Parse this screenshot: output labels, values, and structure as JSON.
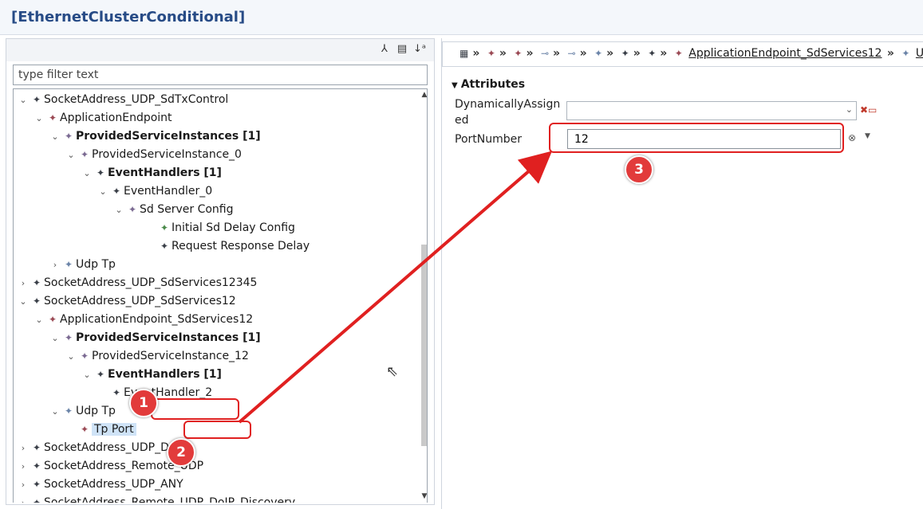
{
  "window": {
    "title": "[EthernetClusterConditional]"
  },
  "left_panel": {
    "toolbar_icons": [
      "merge-icon",
      "document-icon",
      "sort-az-icon"
    ],
    "filter_placeholder": "type filter text",
    "tree": [
      {
        "label": "SocketAddress_UDP_SdTxControl",
        "twisty": "expanded",
        "icon": "dark",
        "bold": false,
        "selected": false
      },
      {
        "label": "ApplicationEndpoint",
        "twisty": "expanded",
        "icon": "red",
        "bold": false,
        "selected": false
      },
      {
        "label": "ProvidedServiceInstances [1]",
        "twisty": "expanded",
        "icon": "purple",
        "bold": true,
        "selected": false
      },
      {
        "label": "ProvidedServiceInstance_0",
        "twisty": "expanded",
        "icon": "purple",
        "bold": false,
        "selected": false
      },
      {
        "label": "EventHandlers [1]",
        "twisty": "expanded",
        "icon": "dark",
        "bold": true,
        "selected": false
      },
      {
        "label": "EventHandler_0",
        "twisty": "expanded",
        "icon": "dark",
        "bold": false,
        "selected": false
      },
      {
        "label": "Sd Server Config",
        "twisty": "expanded",
        "icon": "purple",
        "bold": false,
        "selected": false
      },
      {
        "label": "Initial Sd Delay Config",
        "twisty": "none",
        "icon": "green",
        "bold": false,
        "selected": false
      },
      {
        "label": "Request Response Delay",
        "twisty": "none",
        "icon": "dark",
        "bold": false,
        "selected": false
      },
      {
        "label": "Udp Tp",
        "twisty": "collapsed",
        "icon": "blue",
        "bold": false,
        "selected": false
      },
      {
        "label": "SocketAddress_UDP_SdServices12345",
        "twisty": "collapsed",
        "icon": "dark",
        "bold": false,
        "selected": false
      },
      {
        "label": "SocketAddress_UDP_SdServices12",
        "twisty": "expanded",
        "icon": "dark",
        "bold": false,
        "selected": false
      },
      {
        "label": "ApplicationEndpoint_SdServices12",
        "twisty": "expanded",
        "icon": "red",
        "bold": false,
        "selected": false
      },
      {
        "label": "ProvidedServiceInstances [1]",
        "twisty": "expanded",
        "icon": "purple",
        "bold": true,
        "selected": false
      },
      {
        "label": "ProvidedServiceInstance_12",
        "twisty": "expanded",
        "icon": "purple",
        "bold": false,
        "selected": false
      },
      {
        "label": "EventHandlers [1]",
        "twisty": "expanded",
        "icon": "dark",
        "bold": true,
        "selected": false
      },
      {
        "label": "EventHandler_2",
        "twisty": "none",
        "icon": "dark",
        "bold": false,
        "selected": false
      },
      {
        "label": "Udp Tp",
        "twisty": "expanded",
        "icon": "blue",
        "bold": false,
        "selected": false
      },
      {
        "label": "Tp Port",
        "twisty": "none",
        "icon": "red",
        "bold": false,
        "selected": true
      },
      {
        "label": "SocketAddress_UDP_DoIP",
        "twisty": "collapsed",
        "icon": "dark",
        "bold": false,
        "selected": false
      },
      {
        "label": "SocketAddress_Remote_UDP",
        "twisty": "collapsed",
        "icon": "dark",
        "bold": false,
        "selected": false
      },
      {
        "label": "SocketAddress_UDP_ANY",
        "twisty": "collapsed",
        "icon": "dark",
        "bold": false,
        "selected": false
      },
      {
        "label": "SocketAddress_Remote_UDP_DoIP_Discovery",
        "twisty": "collapsed",
        "icon": "dark",
        "bold": false,
        "selected": false
      }
    ]
  },
  "right_panel": {
    "breadcrumb_link": "ApplicationEndpoint_SdServices12",
    "breadcrumb_tail": "U",
    "section_title": "Attributes",
    "dynamically_assigned_label_line1": "DynamicallyAssign",
    "dynamically_assigned_label_line2": "ed",
    "dynamically_assigned_value": "",
    "port_number_label": "PortNumber",
    "port_number_value": "12"
  },
  "annotations": {
    "badge_1": "1",
    "badge_2": "2",
    "badge_3": "3"
  },
  "colors": {
    "annotation_red": "#e02020",
    "title_blue": "#274b86",
    "selection_bg": "#cfe3f7"
  }
}
